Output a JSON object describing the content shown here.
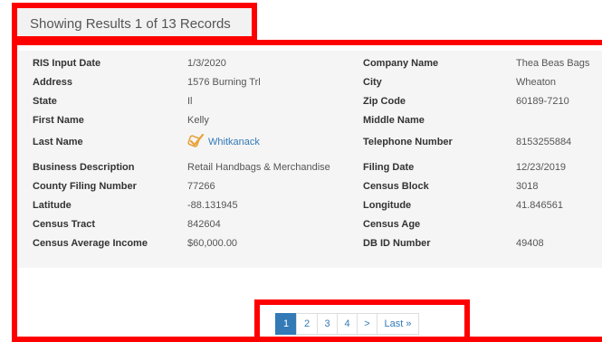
{
  "results": {
    "text": "Showing Results 1 of 13 Records"
  },
  "record": {
    "rows": [
      {
        "l1": "RIS Input Date",
        "v1": "1/3/2020",
        "l2": "Company Name",
        "v2": "Thea Beas Bags"
      },
      {
        "l1": "Address",
        "v1": "1576 Burning Trl",
        "l2": "City",
        "v2": "Wheaton"
      },
      {
        "l1": "State",
        "v1": "Il",
        "l2": "Zip Code",
        "v2": "60189-7210"
      },
      {
        "l1": "First Name",
        "v1": "Kelly",
        "l2": "Middle Name",
        "v2": ""
      },
      {
        "l1": "Last Name",
        "v1": "Whitkanack",
        "l2": "Telephone Number",
        "v2": "8153255884"
      },
      {
        "l1": "Business Description",
        "v1": "Retail Handbags & Merchandise",
        "l2": "Filing Date",
        "v2": "12/23/2019"
      },
      {
        "l1": "County Filing Number",
        "v1": "77266",
        "l2": "Census Block",
        "v2": "3018"
      },
      {
        "l1": "Latitude",
        "v1": "-88.131945",
        "l2": "Longitude",
        "v2": "41.846561"
      },
      {
        "l1": "Census Tract",
        "v1": "842604",
        "l2": "Census Age",
        "v2": ""
      },
      {
        "l1": "Census Average Income",
        "v1": "$60,000.00",
        "l2": "DB ID Number",
        "v2": "49408"
      }
    ],
    "link_color": "#337ab7",
    "check_icon": "verified-check-icon",
    "check_color": "#e8a33d"
  },
  "pagination": {
    "pages": [
      "1",
      "2",
      "3",
      "4"
    ],
    "next": ">",
    "last": "Last »",
    "active_index": 0,
    "accent": "#337ab7"
  }
}
